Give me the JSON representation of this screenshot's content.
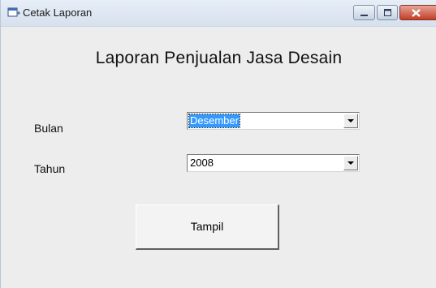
{
  "window": {
    "title": "Cetak Laporan",
    "icon": "app-window-icon",
    "controls": [
      "minimize-icon",
      "maximize-icon",
      "close-icon"
    ],
    "close_color": "#c33e25"
  },
  "form": {
    "heading": "Laporan Penjualan Jasa Desain",
    "bulan": {
      "label": "Bulan",
      "value": "Desember",
      "highlight_color": "#3399ff"
    },
    "tahun": {
      "label": "Tahun",
      "value": "2008"
    },
    "submit_label": "Tampil"
  }
}
